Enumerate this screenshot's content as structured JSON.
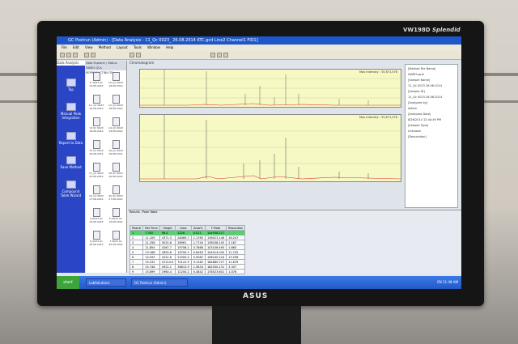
{
  "window": {
    "title": "GC Postrun (Admin) - [Data Analysis - 11_Qc 0023_ 26.08.2014 KTC.gcd Line2 Channel1 FID1]"
  },
  "menu": [
    "File",
    "Edit",
    "View",
    "Method",
    "Layout",
    "Tools",
    "Window",
    "Help"
  ],
  "monitor": {
    "model": "VW198D",
    "mode": "Splendid",
    "brand": "ASUS"
  },
  "tasks": {
    "header": "Data Analysis",
    "items": [
      "Top",
      "Manual Peak Integration",
      "Report to Data",
      "Save Method",
      "Compound Table Wizard"
    ]
  },
  "browser": {
    "tabs": "Data Explorer / Status",
    "report_label": "Report to",
    "path": "FAMES QCs REPRODUCTIBILITE",
    "files": [
      "9. 0023 Qc 19.08.2014",
      "10_Qc 0023 18.08.2014",
      "11. Qc 0023 19.08.2014",
      "12_Qc 0023 18.08.2014",
      "13 Qc 0023 18.08.2014",
      "14_Qc 0023 19.08.2014",
      "15 Qc 0023 26.08.2014",
      "16_Qc 0023 26.08.2014",
      "17_Qc 0023 25.08.2014",
      "18 Qc 0023 26.08.2014",
      "19_Qc 0023 27.08.2014",
      "20 Qc 0023 27.08.2014",
      "4_0023 Qc 19.08.2014",
      "5_0023 Qc 19.08.2014",
      "6_0023 Qc 26.08.2014",
      "7 0023 Qc 26.08.2014"
    ]
  },
  "chromatogram": {
    "header": "Chromatogram",
    "top_label": "Max Intensity : 33,871,576",
    "bottom_label": "Max Intensity : 33,871,576",
    "properties": [
      "[Method File Name]",
      "FAMES.gcm",
      "[Sample Name]",
      "11_Qc 0023 26.08.2014",
      "[Sample ID]",
      "11_Qc 0023 26.08.2014",
      "[Analyzed by]",
      "Admin",
      "[Analyzed Date]",
      "8/26/2014 12:44:49 PM",
      "[Sample Type]",
      "Unknown",
      "[Description]"
    ]
  },
  "results": {
    "header": "Results : Peak Table",
    "tabs": [
      "Peak Table",
      "Compound",
      "Group",
      "Calibration Curve"
    ],
    "columns": [
      "Peak#",
      "Ret.Time",
      "Height",
      "Area",
      "Area%",
      "T.Plate",
      "Resolution"
    ],
    "rows": [
      [
        "1",
        "7.392",
        "98.4",
        "1226",
        "0.011",
        "144958.217",
        ""
      ],
      [
        "2",
        "11.109",
        "4371.3",
        "28469.7",
        "1.1765",
        "136023.146",
        "16.247"
      ],
      [
        "3",
        "11.258",
        "5025.8",
        "28961",
        "1.7740",
        "138038.105",
        "2.167"
      ],
      [
        "4",
        "11.854",
        "4267.7",
        "19706.1",
        "0.7868",
        "103106.495",
        "1.860"
      ],
      [
        "5",
        "13.168",
        "2859.8",
        "19700.1",
        "0.8463",
        "104014.045",
        "11.742"
      ],
      [
        "6",
        "14.933",
        "3222.6",
        "21000.4",
        "0.9082",
        "196240.144",
        "13.256"
      ],
      [
        "7",
        "15.232",
        "10114.0",
        "72122.9",
        "3.1182",
        "184880.727",
        "11.679"
      ],
      [
        "8",
        "15.746",
        "4921.1",
        "36613.9",
        "1.5834",
        "182050.131",
        "3.307"
      ],
      [
        "9",
        "15.899",
        "1960.4",
        "11200.2",
        "0.4842",
        "178523.601",
        "1.076"
      ]
    ],
    "bottom_tabs": [
      "Batch Table",
      "Calibration",
      "Report",
      "Data Analysis"
    ]
  },
  "taskbar": {
    "start": "start",
    "items": [
      "LabSolutions",
      "GC Postrun (Admin)"
    ],
    "lang": "EN",
    "clock": "11:48 AM"
  }
}
